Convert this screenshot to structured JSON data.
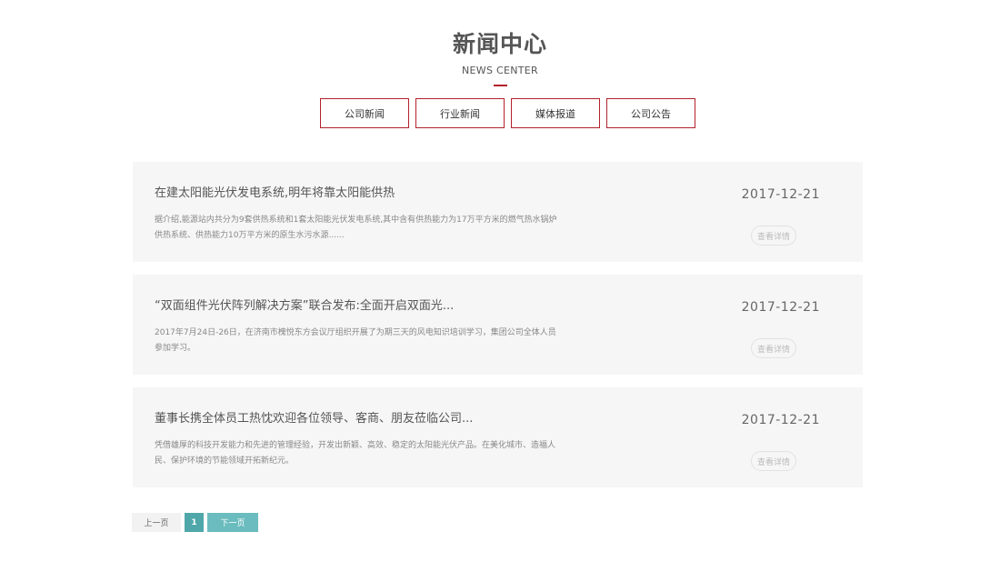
{
  "header": {
    "title": "新闻中心",
    "subtitle": "NEWS CENTER"
  },
  "tabs": [
    {
      "label": "公司新闻"
    },
    {
      "label": "行业新闻"
    },
    {
      "label": "媒体报道"
    },
    {
      "label": "公司公告"
    }
  ],
  "news": [
    {
      "title": "在建太阳能光伏发电系统,明年将靠太阳能供热",
      "desc": "据介绍,能源站内共分为9套供热系统和1套太阳能光伏发电系统,其中含有供热能力为17万平方米的燃气热水锅炉供热系统、供热能力10万平方米的原生水污水源......",
      "date": "2017-12-21",
      "button": "查看详情"
    },
    {
      "title": "“双面组件光伏阵列解决方案”联合发布:全面开启双面光...",
      "desc": "2017年7月24日-26日，在济南市槐悦东方会议厅组织开展了为期三天的风电知识培训学习，集团公司全体人员参加学习。",
      "date": "2017-12-21",
      "button": "查看详情"
    },
    {
      "title": "董事长携全体员工热忱欢迎各位领导、客商、朋友莅临公司...",
      "desc": "凭借雄厚的科技开发能力和先进的管理经验，开发出新颖、高效、稳定的太阳能光伏产品。在美化城市、造福人民、保护环境的节能领域开拓新纪元。",
      "date": "2017-12-21",
      "button": "查看详情"
    }
  ],
  "pagination": {
    "prev": "上一页",
    "current": "1",
    "next": "下一页"
  },
  "colors": {
    "accent": "#b2212b",
    "pager_active": "#4fa7a9",
    "pager_next": "#6bbcbe",
    "card_bg": "#f6f6f6"
  }
}
